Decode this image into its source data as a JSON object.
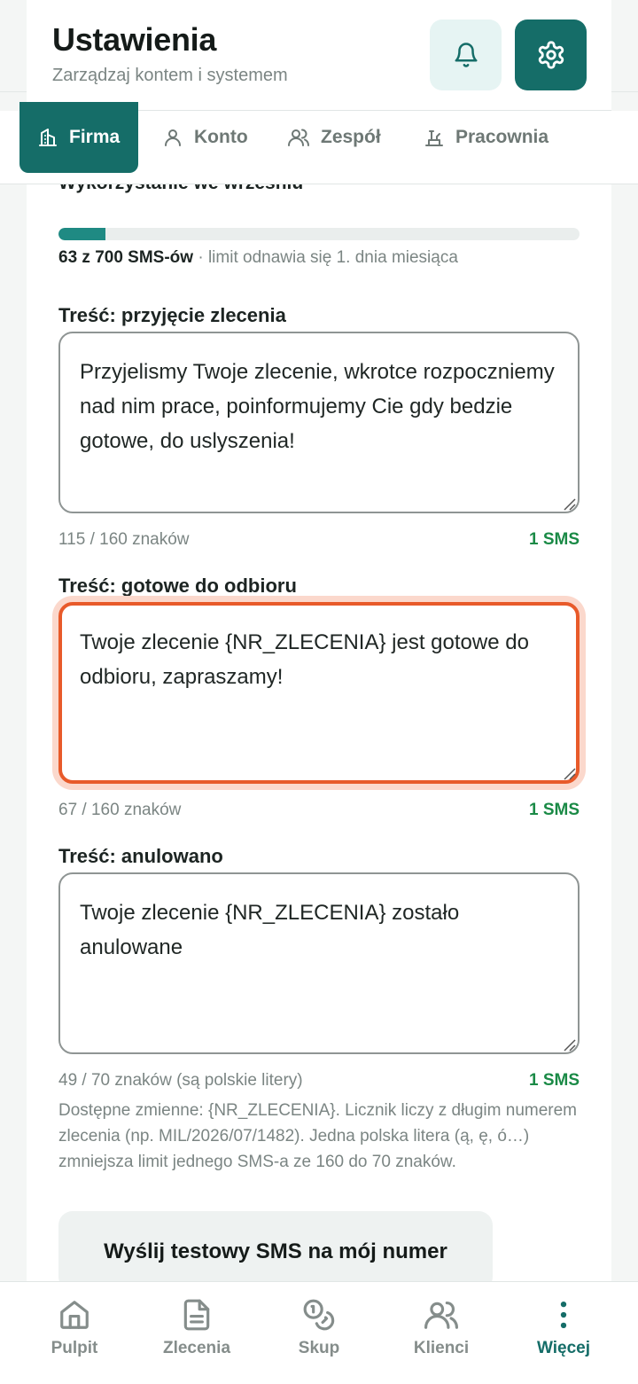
{
  "header": {
    "title": "Ustawienia",
    "subtitle": "Zarządzaj kontem i systemem",
    "notifications_icon": "bell-icon",
    "settings_icon": "gear-icon"
  },
  "tabs": [
    {
      "label": "Firma",
      "icon": "building-icon",
      "active": true
    },
    {
      "label": "Konto",
      "icon": "user-icon",
      "active": false
    },
    {
      "label": "Zespół",
      "icon": "users-icon",
      "active": false
    },
    {
      "label": "Pracownia",
      "icon": "workbench-icon",
      "active": false
    }
  ],
  "usage": {
    "heading": "Wykorzystanie we wrześniu",
    "used_label": "63 z 700 SMS-ów",
    "renew_text": " · limit odnawia się 1. dnia miesiąca",
    "used": 63,
    "limit": 700
  },
  "templates": [
    {
      "label": "Treść: przyjęcie zlecenia",
      "text": "Przyjelismy Twoje zlecenie, wkrotce rozpoczniemy nad nim prace, poinformujemy Cie gdy bedzie gotowe, do uslyszenia!",
      "counter": "115 / 160 znaków",
      "sms": "1 SMS"
    },
    {
      "label": "Treść: gotowe do odbioru",
      "text": "Twoje zlecenie {NR_ZLECENIA} jest gotowe do odbioru, zapraszamy!",
      "counter": "67 / 160 znaków",
      "sms": "1 SMS"
    },
    {
      "label": "Treść: anulowano",
      "text": "Twoje zlecenie {NR_ZLECENIA} zostało anulowane",
      "counter": "49 / 70 znaków (są polskie litery)",
      "sms": "1 SMS"
    }
  ],
  "hint": "Dostępne zmienne: {NR_ZLECENIA}. Licznik liczy z długim numerem zlecenia (np. MIL/2026/07/1482). Jedna polska litera (ą, ę, ó…) zmniejsza limit jednego SMS-a ze 160 do 70 znaków.",
  "test_button": "Wyślij testowy SMS na mój numer",
  "bottom_nav": [
    {
      "label": "Pulpit",
      "icon": "home-icon",
      "active": false
    },
    {
      "label": "Zlecenia",
      "icon": "document-icon",
      "active": false
    },
    {
      "label": "Skup",
      "icon": "coins-icon",
      "active": false
    },
    {
      "label": "Klienci",
      "icon": "users-icon",
      "active": false
    },
    {
      "label": "Więcej",
      "icon": "more-vertical-icon",
      "active": true
    }
  ],
  "colors": {
    "primary": "#156d68",
    "progress": "#1f8a83",
    "focus": "#e85a2a",
    "sms_ok": "#1a8a46"
  }
}
